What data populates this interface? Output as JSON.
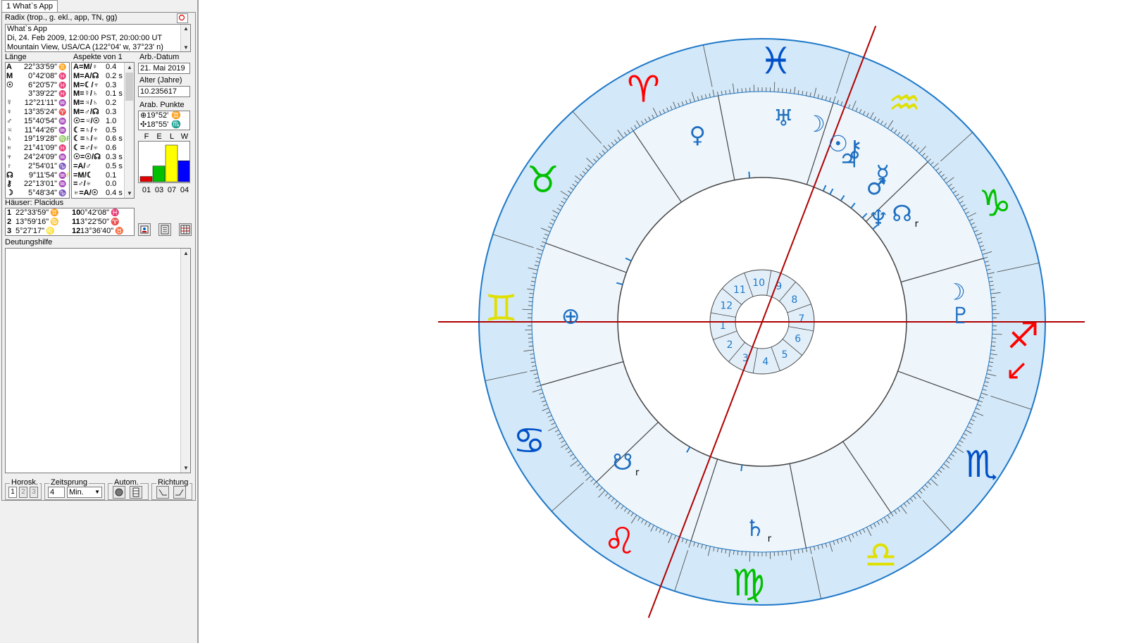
{
  "window": {
    "tab_label": "1 What`s App"
  },
  "header": {
    "chart_type": "Radix (trop., g. ekl., app, TN, gg)"
  },
  "info": {
    "line1": "What`s App",
    "line2": "Di, 24. Feb 2009, 12:00:00 PST, 20:00:00 UT",
    "line3": "Mountain View, USA/CA (122°04' w, 37°23' n)"
  },
  "columns": {
    "laenge": "Länge",
    "aspekte": "Aspekte von 1",
    "arb_datum": "Arb.-Datum",
    "alter": "Alter (Jahre)",
    "arab": "Arab. Punkte",
    "haeuser": "Häuser: Placidus",
    "deutung": "Deutungshilfe"
  },
  "longitudes": [
    {
      "sym": "A",
      "pos": "22°33'59\"",
      "sign": "♊",
      "color": "#e0e000"
    },
    {
      "sym": "M",
      "pos": "0°42'08\"",
      "sign": "♓",
      "color": "#0000ff"
    },
    {
      "sym": "☉",
      "pos": "6°20'57\"",
      "sign": "♓",
      "color": "#0000ff"
    },
    {
      "sym": "",
      "pos": "3°39'22\"",
      "sign": "♓",
      "color": "#0000ff"
    },
    {
      "sym": "☿",
      "pos": "12°21'11\"",
      "sign": "♒",
      "color": "#e0e000"
    },
    {
      "sym": "♀",
      "pos": "13°35'24\"",
      "sign": "♈",
      "color": "#ff0000"
    },
    {
      "sym": "♂",
      "pos": "15°40'54\"",
      "sign": "♒",
      "color": "#e0e000"
    },
    {
      "sym": "♃",
      "pos": "11°44'26\"",
      "sign": "♒",
      "color": "#e0e000"
    },
    {
      "sym": "♄",
      "pos": "19°19'28\"",
      "sign": "♍R",
      "color": "#00c000"
    },
    {
      "sym": "♅",
      "pos": "21°41'09\"",
      "sign": "♓",
      "color": "#0000ff"
    },
    {
      "sym": "♆",
      "pos": "24°24'09\"",
      "sign": "♒",
      "color": "#e0e000"
    },
    {
      "sym": "♇",
      "pos": "2°54'01\"",
      "sign": "♑",
      "color": "#00c000"
    },
    {
      "sym": "☊",
      "pos": "9°11'54\"",
      "sign": "♒R",
      "color": "#e0e000"
    },
    {
      "sym": "⚷",
      "pos": "22°13'01\"",
      "sign": "♒",
      "color": "#e0e000"
    },
    {
      "sym": "☽",
      "pos": "5°48'34\"",
      "sign": "♑",
      "color": "#00c000"
    }
  ],
  "aspects": [
    {
      "text": "A=M/♀",
      "orb": "0.4"
    },
    {
      "text": "M=A/☊",
      "orb": "0.2 s"
    },
    {
      "text": "M=☾/♆",
      "orb": "0.3"
    },
    {
      "text": "M=☿/♄",
      "orb": "0.1 s"
    },
    {
      "text": "M=♃/♄",
      "orb": "0.2"
    },
    {
      "text": "M=♂/☊",
      "orb": "0.3"
    },
    {
      "text": "☉=♃/☉",
      "orb": "1.0"
    },
    {
      "text": "☾=♄/♆",
      "orb": "0.5"
    },
    {
      "text": "☾=♄/♅",
      "orb": "0.6 s"
    },
    {
      "text": "☾=♂/♅",
      "orb": "0.6"
    },
    {
      "text": "☉=☉/☊",
      "orb": "0.3 s"
    },
    {
      "text": "=A/♂",
      "orb": "0.5 s"
    },
    {
      "text": "=M/☾",
      "orb": "0.1"
    },
    {
      "text": "=♂/♅",
      "orb": "0.0"
    },
    {
      "text": "♅=A/☉",
      "orb": "0.4 s"
    }
  ],
  "arb_datum_value": "21. Mai 2019",
  "alter_value": "10.235617",
  "arab_points": [
    {
      "sym": "⊕",
      "pos": "19°52'",
      "sign": "♊"
    },
    {
      "sym": "✣",
      "pos": "18°55'",
      "sign": "♏"
    }
  ],
  "elements": {
    "labels": [
      "F",
      "E",
      "L",
      "W"
    ],
    "values": [
      1,
      3,
      7,
      4
    ],
    "value_labels": [
      "01",
      "03",
      "07",
      "04"
    ],
    "colors": [
      "#e00000",
      "#00c000",
      "#ffff00",
      "#0000ff"
    ]
  },
  "houses": [
    {
      "n": "1",
      "pos": "22°33'59\"",
      "sign": "♊",
      "color": "#e0e000"
    },
    {
      "n": "10",
      "pos": "0°42'08\"",
      "sign": "♓",
      "color": "#0000ff"
    },
    {
      "n": "2",
      "pos": "13°59'16\"",
      "sign": "♋",
      "color": "#0000ff"
    },
    {
      "n": "11",
      "pos": "3°22'50\"",
      "sign": "♈",
      "color": "#ff0000"
    },
    {
      "n": "3",
      "pos": "5°27'17\"",
      "sign": "♌",
      "color": "#ff0000"
    },
    {
      "n": "12",
      "pos": "13°36'40\"",
      "sign": "♉",
      "color": "#00c000"
    }
  ],
  "bottom": {
    "horosk": "Horosk.",
    "horosk_items": [
      "1",
      "2",
      "3"
    ],
    "zeitsprung": "Zeitsprung",
    "zeitsprung_value": "4",
    "zeitsprung_unit": "Min.",
    "autom": "Autom.",
    "richtung": "Richtung"
  },
  "wheel": {
    "zodiac": [
      {
        "glyph": "♓",
        "color": "#0050c8"
      },
      {
        "glyph": "♈",
        "color": "#ff0000"
      },
      {
        "glyph": "♉",
        "color": "#00c000"
      },
      {
        "glyph": "♊",
        "color": "#e0e000"
      },
      {
        "glyph": "♋",
        "color": "#0050c8"
      },
      {
        "glyph": "♌",
        "color": "#ff0000"
      },
      {
        "glyph": "♍",
        "color": "#00c000"
      },
      {
        "glyph": "♎",
        "color": "#e0e000"
      },
      {
        "glyph": "♏",
        "color": "#0050c8"
      },
      {
        "glyph": "♐",
        "color": "#ff0000"
      },
      {
        "glyph": "♑",
        "color": "#00c000"
      },
      {
        "glyph": "♒",
        "color": "#e0e000"
      }
    ],
    "house_numbers": [
      "10",
      "9",
      "8",
      "7",
      "6",
      "5",
      "4",
      "3",
      "2",
      "1",
      "12",
      "11"
    ],
    "planets": [
      {
        "glyph": "♅",
        "label": ""
      },
      {
        "glyph": "♀",
        "label": ""
      },
      {
        "glyph": "☽",
        "label": ""
      },
      {
        "glyph": "☉",
        "label": ""
      },
      {
        "glyph": "⚷",
        "label": ""
      },
      {
        "glyph": "♃",
        "label": ""
      },
      {
        "glyph": "☿",
        "label": ""
      },
      {
        "glyph": "♂",
        "label": ""
      },
      {
        "glyph": "☊",
        "label": "r"
      },
      {
        "glyph": "♆",
        "label": ""
      },
      {
        "glyph": "☽",
        "label": ""
      },
      {
        "glyph": "♇",
        "label": ""
      },
      {
        "glyph": "⊕",
        "label": ""
      },
      {
        "glyph": "☋",
        "label": "r"
      },
      {
        "glyph": "♄",
        "label": "r"
      }
    ]
  }
}
